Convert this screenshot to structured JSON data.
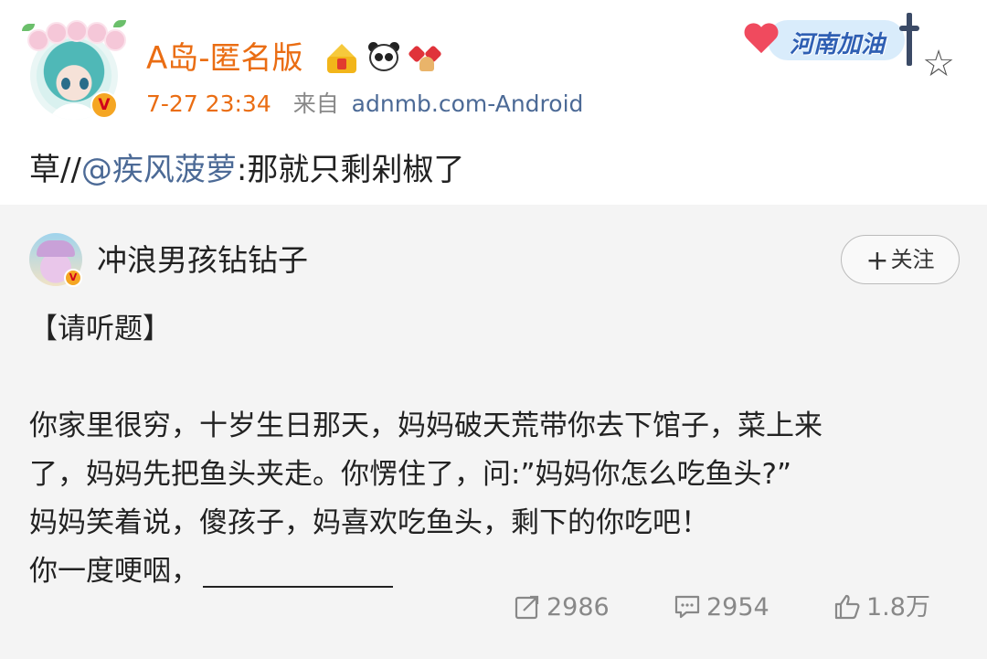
{
  "author": {
    "name": "A岛-匿名版",
    "time": "7-27 23:34",
    "from_label": "来自",
    "source": "adnmb.com-Android",
    "verified_mark": "V"
  },
  "topic_badge": {
    "text": "河南加油"
  },
  "post": {
    "prefix": "草//",
    "mention": "@疾风菠萝",
    "rest": ":那就只剩剁椒了"
  },
  "retweet": {
    "author": {
      "name": "冲浪男孩钻钻子",
      "verified_mark": "V"
    },
    "follow_label": "关注",
    "lines": [
      "【请听题】",
      "",
      "你家里很穷，十岁生日那天，妈妈破天荒带你去下馆子，菜上来",
      "了，妈妈先把鱼头夹走。你愣住了，问:”妈妈你怎么吃鱼头?”",
      "妈妈笑着说，傻孩子，妈喜欢吃鱼头，剩下的你吃吧！"
    ],
    "last_line": "你一度哽咽，",
    "actions": {
      "repost": "2986",
      "comment": "2954",
      "like": "1.8万"
    }
  },
  "icons": [
    "crown-badge-icon",
    "panda-icon",
    "bow-bell-icon",
    "star-icon",
    "repost-icon",
    "comment-icon",
    "like-icon"
  ]
}
